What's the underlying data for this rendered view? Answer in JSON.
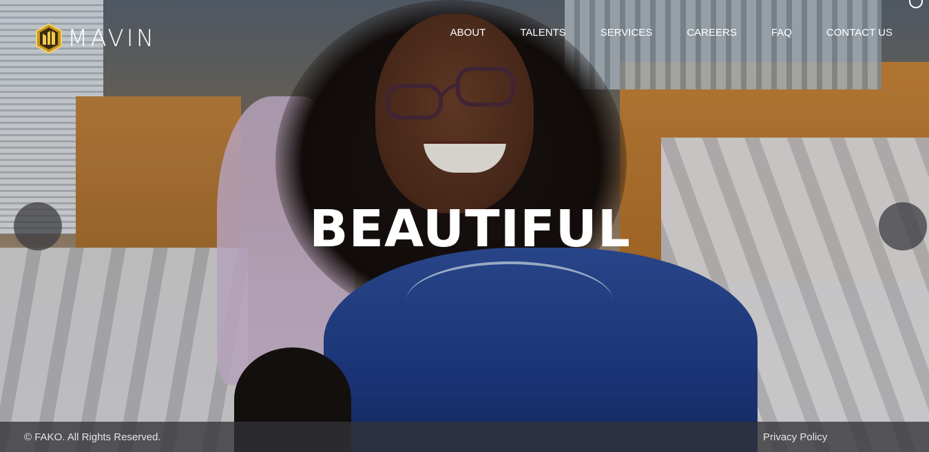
{
  "brand": {
    "name": "MAVIN",
    "logo_colors": [
      "#f2c94c",
      "#b8860b"
    ]
  },
  "nav": {
    "items": [
      {
        "label": "ABOUT"
      },
      {
        "label": "TALENTS"
      },
      {
        "label": "SERVICES"
      },
      {
        "label": "CAREERS"
      },
      {
        "label": "FAQ"
      },
      {
        "label": "CONTACT US"
      }
    ]
  },
  "hero": {
    "headline": "BEAUTIFUL"
  },
  "carousel": {
    "prev_icon": "arrow-left-icon",
    "next_icon": "arrow-right-icon"
  },
  "footer": {
    "copyright": "© FAKO. All Rights Reserved.",
    "privacy_label": "Privacy Policy"
  }
}
